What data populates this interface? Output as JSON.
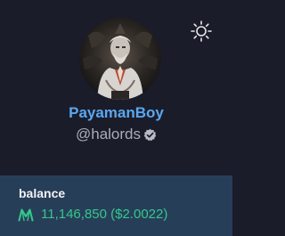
{
  "profile": {
    "display_name": "PayamanBoy",
    "handle": "@halords",
    "verified": true
  },
  "balance": {
    "label": "balance",
    "amount": "11,146,850 ($2.0022)",
    "token_icon": "token-m-icon"
  },
  "controls": {
    "theme_icon": "sun-icon"
  },
  "colors": {
    "background": "#1b1c2a",
    "name": "#5aa8ef",
    "handle": "#a9acb6",
    "panel": "#273e59",
    "amount": "#33c98b"
  }
}
